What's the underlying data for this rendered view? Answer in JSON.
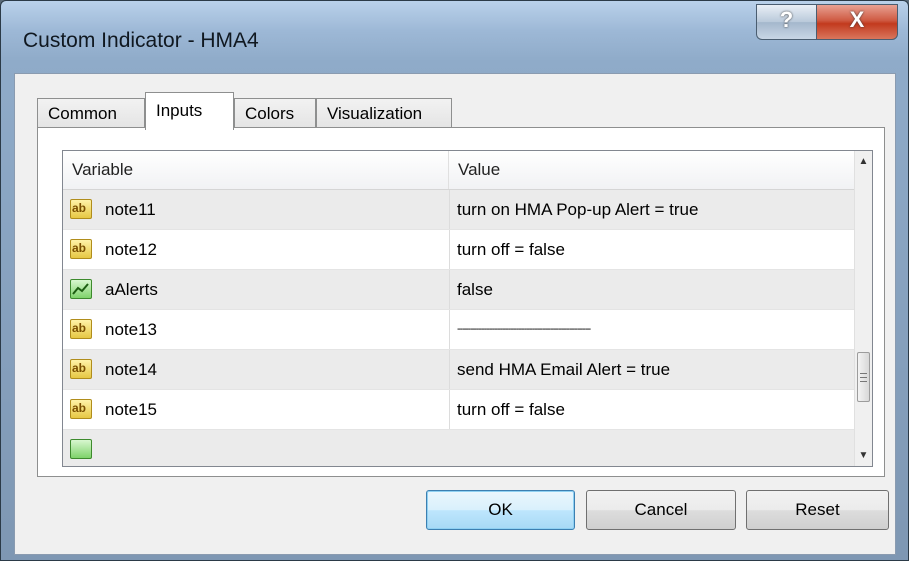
{
  "window": {
    "title": "Custom Indicator - HMA4"
  },
  "titlebar": {
    "help_label": "?",
    "close_label": "X"
  },
  "tabs": [
    {
      "label": "Common",
      "active": false
    },
    {
      "label": "Inputs",
      "active": true
    },
    {
      "label": "Colors",
      "active": false
    },
    {
      "label": "Visualization",
      "active": false
    }
  ],
  "grid": {
    "columns": {
      "variable": "Variable",
      "value": "Value"
    },
    "rows": [
      {
        "variable": "note11",
        "value": "turn on HMA Pop-up Alert = true",
        "icon": "string-ab-icon"
      },
      {
        "variable": "note12",
        "value": "turn off = false",
        "icon": "string-ab-icon"
      },
      {
        "variable": "aAlerts",
        "value": "false",
        "icon": "bool-chart-icon"
      },
      {
        "variable": "note13",
        "value": "--------------------------------------------------",
        "icon": "string-ab-icon"
      },
      {
        "variable": "note14",
        "value": "send HMA Email Alert = true",
        "icon": "string-ab-icon"
      },
      {
        "variable": "note15",
        "value": "turn off = false",
        "icon": "string-ab-icon"
      }
    ]
  },
  "buttons": {
    "ok": "OK",
    "cancel": "Cancel",
    "reset": "Reset"
  },
  "colors": {
    "accent": "#3c7fb1",
    "row_alt": "#ebebeb"
  }
}
